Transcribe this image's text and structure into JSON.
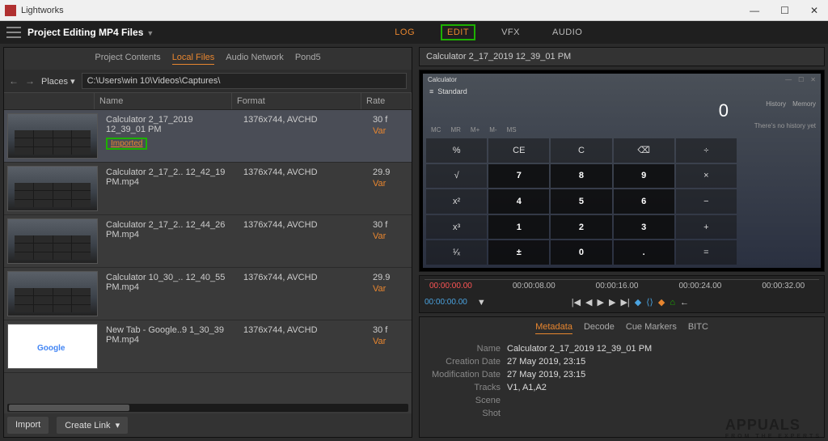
{
  "window": {
    "title": "Lightworks"
  },
  "project": {
    "title": "Project Editing MP4 Files"
  },
  "modeTabs": {
    "log": "LOG",
    "edit": "EDIT",
    "vfx": "VFX",
    "audio": "AUDIO"
  },
  "subtabs": {
    "pc": "Project Contents",
    "lf": "Local Files",
    "an": "Audio Network",
    "p5": "Pond5"
  },
  "pathbar": {
    "places": "Places",
    "path": "C:\\Users\\win 10\\Videos\\Captures\\"
  },
  "columns": {
    "name": "Name",
    "format": "Format",
    "rate": "Rate"
  },
  "files": [
    {
      "name": "Calculator 2_17_2019 12_39_01 PM",
      "imported": "Imported",
      "format": "1376x744, AVCHD",
      "rate": "30 f",
      "rate2": "Var"
    },
    {
      "name": "Calculator 2_17_2.. 12_42_19 PM.mp4",
      "format": "1376x744, AVCHD",
      "rate": "29.9",
      "rate2": "Var"
    },
    {
      "name": "Calculator 2_17_2.. 12_44_26 PM.mp4",
      "format": "1376x744, AVCHD",
      "rate": "30 f",
      "rate2": "Var"
    },
    {
      "name": "Calculator 10_30_.. 12_40_55 PM.mp4",
      "format": "1376x744, AVCHD",
      "rate": "29.9",
      "rate2": "Var"
    },
    {
      "name": "New Tab - Google..9 1_30_39 PM.mp4",
      "format": "1376x744, AVCHD",
      "rate": "30 f",
      "rate2": "Var"
    }
  ],
  "bottom": {
    "import": "Import",
    "createLink": "Create Link"
  },
  "preview": {
    "title": "Calculator 2_17_2019 12_39_01 PM"
  },
  "calc": {
    "app": "Calculator",
    "mode": "Standard",
    "history": "History",
    "memory": "Memory",
    "nohist": "There's no history yet",
    "display": "0",
    "mem": [
      "MC",
      "MR",
      "M+",
      "M-",
      "MS"
    ],
    "keys": [
      [
        "%",
        "CE",
        "C",
        "⌫",
        "÷"
      ],
      [
        "√",
        "7",
        "8",
        "9",
        "×"
      ],
      [
        "x²",
        "4",
        "5",
        "6",
        "−"
      ],
      [
        "x³",
        "1",
        "2",
        "3",
        "+"
      ],
      [
        "¹⁄ₓ",
        "±",
        "0",
        ".",
        "="
      ]
    ]
  },
  "timeline": {
    "marks": [
      "00:00:00.00",
      "00:00:08.00",
      "00:00:16.00",
      "00:00:24.00",
      "00:00:32.00"
    ],
    "current": "00:00:00.00"
  },
  "metatabs": {
    "meta": "Metadata",
    "decode": "Decode",
    "cue": "Cue Markers",
    "bitc": "BITC"
  },
  "meta": {
    "nameL": "Name",
    "nameV": "Calculator 2_17_2019 12_39_01 PM",
    "cdL": "Creation Date",
    "cdV": "27 May 2019, 23:15",
    "mdL": "Modification Date",
    "mdV": "27 May 2019, 23:15",
    "trL": "Tracks",
    "trV": "V1, A1,A2",
    "scL": "Scene",
    "scV": "",
    "shL": "Shot",
    "shV": ""
  },
  "watermark": {
    "main": "APPUALS",
    "sub": "FROM THE EXPERTS"
  }
}
